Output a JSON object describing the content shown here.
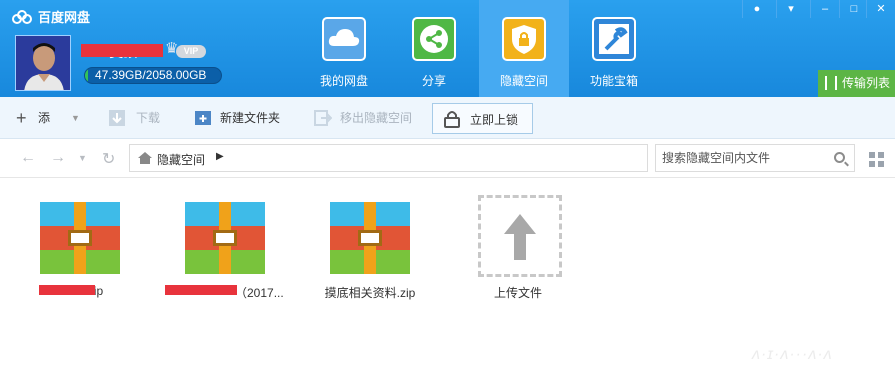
{
  "app": {
    "title": "百度网盘"
  },
  "user": {
    "name": "D.X.莫顶6",
    "vip_badge": "VIP",
    "quota_text": "47.39GB/2058.00GB",
    "quota_used_fraction": 0.023
  },
  "nav": [
    {
      "label": "我的网盘",
      "icon": "cloud-icon",
      "color": "#5aa7e8"
    },
    {
      "label": "分享",
      "icon": "share-icon",
      "color": "#4fb845"
    },
    {
      "label": "隐藏空间",
      "icon": "shield-lock-icon",
      "color": "#f2b21a",
      "active": true
    },
    {
      "label": "功能宝箱",
      "icon": "wrench-icon",
      "color": "#2f86d8"
    }
  ],
  "window_controls": [
    "bell-icon",
    "menu-icon",
    "minimize-icon",
    "maximize-icon",
    "close-icon"
  ],
  "transfer": {
    "label": "传输列表"
  },
  "toolbar": {
    "add": "添加",
    "download": "下载",
    "new_folder": "新建文件夹",
    "move_out": "移出隐藏空间",
    "lock": "立即上锁"
  },
  "breadcrumb": {
    "current": "隐藏空间"
  },
  "search": {
    "placeholder": "搜索隐藏空间内文件"
  },
  "files": [
    {
      "name": "P.zip"
    },
    {
      "name": "（2017..."
    },
    {
      "name": "摸底相关资料.zip"
    }
  ],
  "upload": {
    "label": "上传文件"
  },
  "colors": {
    "header": "#1f8fe0",
    "active_tab": "#46aaf2",
    "transfer": "#5cb545"
  }
}
